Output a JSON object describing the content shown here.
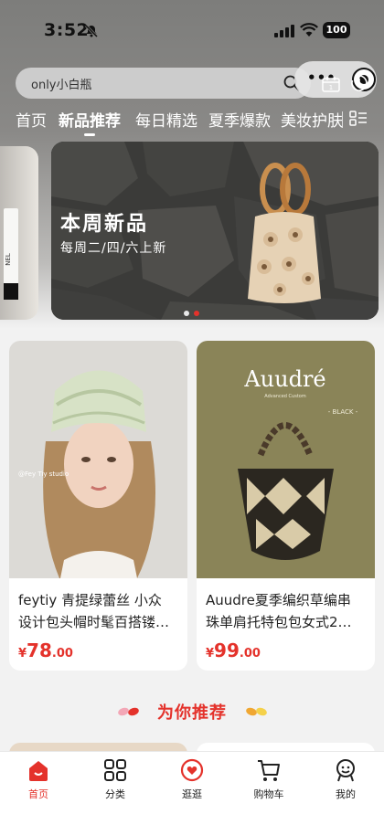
{
  "status_bar": {
    "time": "3:52",
    "battery": "100"
  },
  "search": {
    "text": "only小白瓶"
  },
  "capsule": {
    "dots": "•••"
  },
  "tabs": [
    {
      "label": "首页",
      "active": false
    },
    {
      "label": "新品推荐",
      "active": true
    },
    {
      "label": "每日精选",
      "active": false
    },
    {
      "label": "夏季爆款",
      "active": false
    },
    {
      "label": "美妆护肤",
      "active": false
    }
  ],
  "side_card": {
    "label": "NEL"
  },
  "banner": {
    "title": "本周新品",
    "subtitle": "每周二/四/六上新"
  },
  "products": [
    {
      "title": "feytiy 青提绿蕾丝 小众设计包头帽时髦百搭镂空",
      "line1": "feytiy 青提绿蕾丝 小众",
      "line2": "设计包头帽时髦百搭镂…",
      "price_symbol": "¥",
      "price_int": "78",
      "price_dec": ".00",
      "image_caption": "@Fey Tiy studio"
    },
    {
      "title": "Auudre夏季编织草编串珠单肩托特包包女式2…",
      "line1": "Auudre夏季编织草编串",
      "line2": "珠单肩托特包包女式2…",
      "price_symbol": "¥",
      "price_int": "99",
      "price_dec": ".00",
      "image_brand": "Auudré",
      "image_tagline": "Advanced Custom",
      "image_badge": "- BLACK -"
    }
  ],
  "recommend": {
    "title": "为你推荐"
  },
  "bottom_nav": [
    {
      "label": "首页",
      "icon": "home-icon",
      "active": true
    },
    {
      "label": "分类",
      "icon": "category-icon",
      "active": false
    },
    {
      "label": "逛逛",
      "icon": "browse-icon",
      "active": false
    },
    {
      "label": "购物车",
      "icon": "cart-icon",
      "active": false
    },
    {
      "label": "我的",
      "icon": "profile-icon",
      "active": false
    }
  ],
  "colors": {
    "accent": "#e4322b",
    "banner_dot_active": "#e4322b"
  }
}
